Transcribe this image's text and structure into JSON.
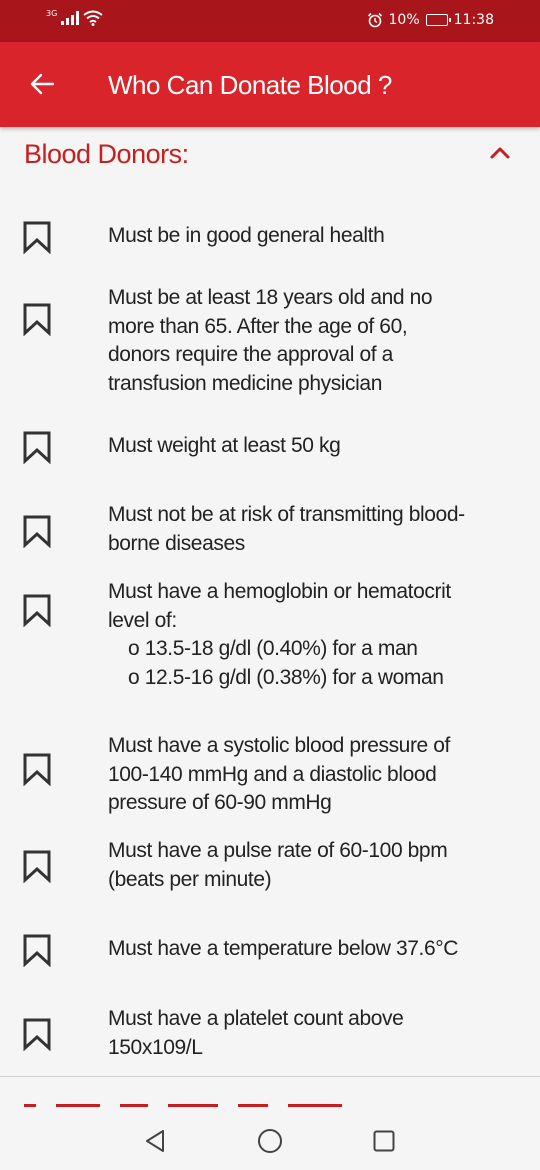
{
  "status_bar": {
    "network": "3G",
    "battery_percent": "10%",
    "time": "11:38",
    "icons": [
      "signal-icon",
      "wifi-icon",
      "alarm-icon",
      "battery-icon"
    ]
  },
  "app_bar": {
    "title": "Who Can Donate Blood ?",
    "back_icon": "arrow-left-icon",
    "background": "#d8242a"
  },
  "section": {
    "title": "Blood Donors:",
    "accent": "#c5201f",
    "collapse_icon": "chevron-up-icon"
  },
  "items": [
    {
      "lines": [
        "Must be in good general health"
      ]
    },
    {
      "lines": [
        "Must be at least 18 years old and no",
        "more than 65. After the age of 60,",
        "donors require the approval of a",
        "transfusion medicine physician"
      ]
    },
    {
      "lines": [
        "Must weight at least 50 kg"
      ]
    },
    {
      "lines": [
        "Must not be at risk of transmitting blood-",
        "borne diseases"
      ]
    },
    {
      "lines": [
        "Must have a hemoglobin or hematocrit",
        "level of:"
      ],
      "sub": [
        "o 13.5-18 g/dl (0.40%) for a man",
        "o 12.5-16 g/dl (0.38%) for a woman"
      ]
    },
    {
      "lines": [
        "Must have a systolic blood pressure of",
        "100-140 mmHg and a diastolic blood",
        "pressure of 60-90 mmHg"
      ]
    },
    {
      "lines": [
        "Must have a pulse rate of 60-100 bpm",
        "(beats per minute)"
      ]
    },
    {
      "lines": [
        "Must have a temperature below 37.6°C"
      ]
    },
    {
      "lines": [
        "Must have a platelet count above",
        "150x109/L"
      ]
    }
  ],
  "nav_bar": {
    "icons": [
      "back-triangle-icon",
      "home-circle-icon",
      "recents-square-icon"
    ]
  }
}
